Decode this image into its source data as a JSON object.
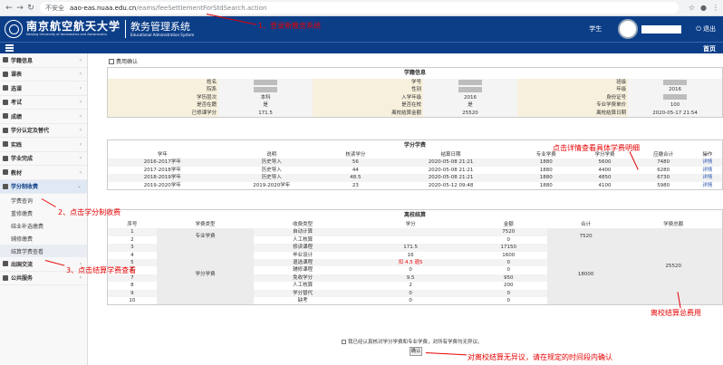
{
  "browser": {
    "insecure_label": "不安全",
    "url_domain": "aao-eas.nuaa.edu.cn",
    "url_path": "/eams/feeSettlementForStdSearch.action"
  },
  "header": {
    "university_cn": "南京航空航天大学",
    "university_en": "Nanjing University of Aeronautics and Astronautics",
    "system_cn": "教务管理系统",
    "system_en": "Educational Administration System",
    "role": "学生",
    "logout": "退出",
    "home": "首页"
  },
  "sidebar": {
    "items": [
      {
        "label": "学籍信息"
      },
      {
        "label": "课表"
      },
      {
        "label": "选课"
      },
      {
        "label": "考试"
      },
      {
        "label": "成绩"
      },
      {
        "label": "学分认定及替代"
      },
      {
        "label": "实践"
      },
      {
        "label": "学业完成"
      },
      {
        "label": "教材"
      },
      {
        "label": "学分制收费"
      }
    ],
    "sub_items": [
      {
        "label": "学费查询"
      },
      {
        "label": "重修缴费"
      },
      {
        "label": "结业补选缴费"
      },
      {
        "label": "辅修缴费"
      },
      {
        "label": "结算学费查看"
      }
    ],
    "bottom_items": [
      {
        "label": "出国交流"
      },
      {
        "label": "公共服务"
      }
    ]
  },
  "breadcrumb": "费用确认",
  "student_info": {
    "title": "学籍信息",
    "rows": [
      [
        "姓名",
        "",
        "学号",
        "",
        "班级",
        ""
      ],
      [
        "院系",
        "",
        "性别",
        "",
        "年级",
        "2016"
      ],
      [
        "学历层次",
        "本科",
        "入学年级",
        "2016",
        "身份证号",
        ""
      ],
      [
        "是否在籍",
        "是",
        "是否在校",
        "是",
        "专业学费单价",
        "100"
      ],
      [
        "已修课学分",
        "171.5",
        "离校结算金额",
        "25520",
        "离校结算日期",
        "2020-05-17 21:54"
      ]
    ]
  },
  "yearly": {
    "title": "学分学费",
    "headers": [
      "学年",
      "说明",
      "核读学分",
      "结算日期",
      "专业学费",
      "学分学费",
      "应缴合计",
      "操作"
    ],
    "rows": [
      [
        "2016-2017学年",
        "历史导入",
        "56",
        "2020-05-08 21:21",
        "1880",
        "5600",
        "7480",
        "详情"
      ],
      [
        "2017-2018学年",
        "历史导入",
        "44",
        "2020-05-08 21:21",
        "1880",
        "4400",
        "6280",
        "详情"
      ],
      [
        "2018-2019学年",
        "历史导入",
        "48.5",
        "2020-05-08 21:21",
        "1880",
        "4850",
        "6730",
        "详情"
      ],
      [
        "2019-2020学年",
        "2019-2020学年",
        "23",
        "2020-05-12 09:48",
        "1880",
        "4100",
        "5980",
        "详情"
      ]
    ]
  },
  "settlement": {
    "title": "离校结算",
    "headers": [
      "序号",
      "学费类型",
      "收费类型",
      "学分",
      "金额",
      "合计",
      "学费总额"
    ],
    "group_labels": [
      "专业学费",
      "学分学费"
    ],
    "subtotals": [
      "7520",
      "18000"
    ],
    "grand_total": "25520",
    "rows": [
      [
        "1",
        "自动计算",
        "",
        "7520"
      ],
      [
        "2",
        "人工核算",
        "",
        "0"
      ],
      [
        "3",
        "修读课程",
        "171.5",
        "17150"
      ],
      [
        "4",
        "毕业设计",
        "16",
        "1600"
      ],
      [
        "5",
        "退选课程",
        "扣 4.5 退5",
        "0"
      ],
      [
        "6",
        "辅修课程",
        "0",
        "0"
      ],
      [
        "7",
        "免收学分",
        "9.5",
        "950"
      ],
      [
        "8",
        "人工核算",
        "2",
        "200"
      ],
      [
        "9",
        "学分替代",
        "0",
        "0"
      ],
      [
        "10",
        "缺考",
        "0",
        "0"
      ]
    ]
  },
  "confirm": {
    "checkbox_label": "我已经认真核对学分学费和专业学费，对所有学费均无异议。",
    "button": "确认"
  },
  "annotations": {
    "a1": "1、登录新教务系统",
    "a2": "2、点击学分制收费",
    "a3": "3、点击结算学费查看",
    "a4": "点击详情查看具体学费明细",
    "a5": "离校结算总费用",
    "a6": "对离校结算无异议，请在规定的时间段内确认"
  },
  "colors": {
    "header_bg": "#0c3e88",
    "annotation": "#e60000",
    "label_bg": "#f7f0dd"
  }
}
